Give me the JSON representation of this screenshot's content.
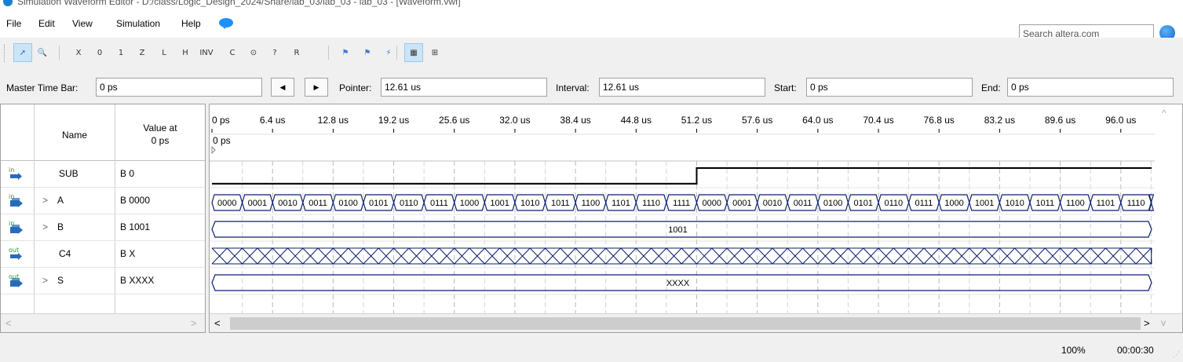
{
  "window": {
    "title": "Simulation Waveform Editor - D:/class/Logic_Design_2024/Share/lab_03/lab_03 - lab_03 - [Waveform.vwf]"
  },
  "menu": {
    "items": [
      {
        "label": "File",
        "key": "F"
      },
      {
        "label": "Edit",
        "key": "E"
      },
      {
        "label": "View",
        "key": "V"
      },
      {
        "label": "Simulation",
        "key": "S"
      },
      {
        "label": "Help",
        "key": "H"
      }
    ],
    "search_placeholder": "Search altera.com"
  },
  "toolbar": {
    "tools": [
      {
        "name": "selection-tool-icon",
        "glyph": "➚",
        "active": true
      },
      {
        "name": "zoom-tool-icon",
        "glyph": "🔍",
        "active": false
      },
      {
        "name": "forcing-unknown-icon",
        "glyph": "X",
        "active": false
      },
      {
        "name": "forcing-low-icon",
        "glyph": "0",
        "active": false
      },
      {
        "name": "forcing-high-icon",
        "glyph": "1",
        "active": false
      },
      {
        "name": "high-impedance-icon",
        "glyph": "Z",
        "active": false
      },
      {
        "name": "weak-low-icon",
        "glyph": "L",
        "active": false
      },
      {
        "name": "weak-high-icon",
        "glyph": "H",
        "active": false
      },
      {
        "name": "invert-icon",
        "glyph": "INV",
        "active": false
      },
      {
        "name": "count-value-icon",
        "glyph": "C",
        "active": false
      },
      {
        "name": "overwrite-clock-icon",
        "glyph": "⊙",
        "active": false
      },
      {
        "name": "arbitrary-value-icon",
        "glyph": "?",
        "active": false
      },
      {
        "name": "random-values-icon",
        "glyph": "R",
        "active": false
      },
      {
        "name": "run-functional-simulation-icon",
        "glyph": "⚑",
        "active": false
      },
      {
        "name": "run-timing-simulation-icon",
        "glyph": "⚑",
        "active": false
      },
      {
        "name": "generate-netlist-icon",
        "glyph": "⚡",
        "active": false
      },
      {
        "name": "snap-to-grid-icon",
        "glyph": "▦",
        "active": true
      },
      {
        "name": "group-icon",
        "glyph": "⊞",
        "active": false
      }
    ]
  },
  "timebar": {
    "master_label": "Master Time Bar:",
    "master_value": "0 ps",
    "prev_label": "◀",
    "next_label": "▶",
    "pointer_label": "Pointer:",
    "pointer_value": "12.61 us",
    "interval_label": "Interval:",
    "interval_value": "12.61 us",
    "start_label": "Start:",
    "start_value": "0 ps",
    "end_label": "End:",
    "end_value": "0 ps"
  },
  "grid": {
    "name_header": "Name",
    "value_header_line1": "Value at",
    "value_header_line2": "0 ps",
    "cursor_label": "0 ps",
    "ticks": [
      "0 ps",
      "6.4 us",
      "12.8 us",
      "19.2 us",
      "25.6 us",
      "32.0 us",
      "38.4 us",
      "44.8 us",
      "51.2 us",
      "57.6 us",
      "64.0 us",
      "70.4 us",
      "76.8 us",
      "83.2 us",
      "89.6 us",
      "96.0 us"
    ],
    "tick_step_us": 6.4,
    "time_range_us": [
      0,
      100
    ]
  },
  "signals": [
    {
      "name": "SUB",
      "dir": "in",
      "expandable": false,
      "value": "B 0",
      "wave": {
        "type": "step",
        "low_until_us": 51.2
      }
    },
    {
      "name": "A",
      "dir": "in",
      "expandable": true,
      "value": "B 0000",
      "wave": {
        "type": "bus_count",
        "period_us": 3.2,
        "labels": [
          "0000",
          "0001",
          "0010",
          "0011",
          "0100",
          "0101",
          "0110",
          "0111",
          "1000",
          "1001",
          "1010",
          "1011",
          "1100",
          "1101",
          "1110",
          "1111"
        ]
      }
    },
    {
      "name": "B",
      "dir": "in",
      "expandable": true,
      "value": "B 1001",
      "wave": {
        "type": "bus_const",
        "label": "1001"
      }
    },
    {
      "name": "C4",
      "dir": "out",
      "expandable": false,
      "value": "B X",
      "wave": {
        "type": "unknown",
        "period_us": 1.6
      }
    },
    {
      "name": "S",
      "dir": "out",
      "expandable": true,
      "value": "B XXXX",
      "wave": {
        "type": "bus_const",
        "label": "XXXX"
      }
    }
  ],
  "status": {
    "zoom": "100%",
    "time": "00:00:30"
  },
  "colors": {
    "wave_bus": "#0a1e6e",
    "wave_line": "#000000",
    "grid": "#b8b8b8",
    "icon_in": "#2a6bb8",
    "icon_label": "#1a9c3a"
  }
}
